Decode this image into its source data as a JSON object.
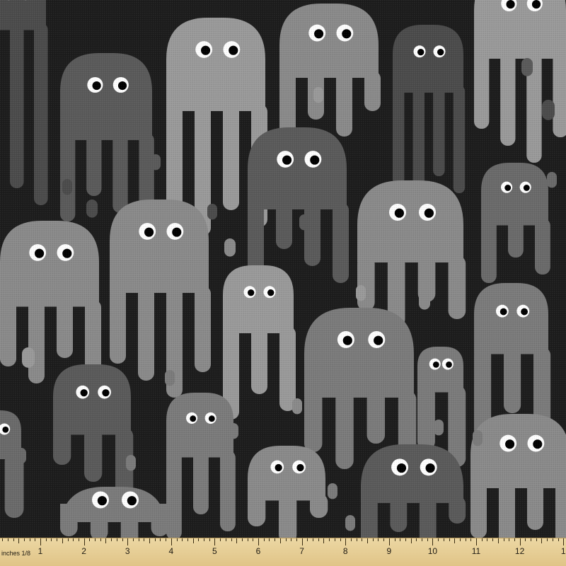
{
  "pattern": {
    "motif": "ghost-jellyfish-icon",
    "background_color": "#1c1c1c",
    "ghost_colors": [
      "#9a9a9a",
      "#8a8a8a",
      "#7b7b7b",
      "#6a6a6a",
      "#5a5a5a",
      "#4b4b4b",
      "#a5a5a5"
    ],
    "eye_white": "#ffffff",
    "eye_pupil": "#000000"
  },
  "ruler": {
    "unit_label": "inches 1/8",
    "numbers": [
      "1",
      "2",
      "3",
      "4",
      "5",
      "6",
      "7",
      "8",
      "9",
      "10",
      "11",
      "12",
      "1"
    ]
  }
}
